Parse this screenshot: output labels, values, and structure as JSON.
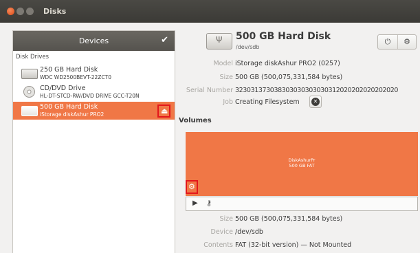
{
  "window": {
    "title": "Disks"
  },
  "sidebar": {
    "header": "Devices",
    "check_glyph": "✔",
    "section_label": "Disk Drives",
    "drives": [
      {
        "name": "250 GB Hard Disk",
        "model": "WDC WD2500BEVT-22ZCT0",
        "icon": "hard-disk-icon"
      },
      {
        "name": "CD/DVD Drive",
        "model": "HL-DT-STCD-RW/DVD DRIVE GCC-T20N",
        "icon": "optical-disc-icon"
      },
      {
        "name": "500 GB Hard Disk",
        "model": "iStorage diskAshur PRO2",
        "icon": "usb-disk-icon",
        "selected": true,
        "eject_glyph": "⏏"
      }
    ]
  },
  "disk": {
    "title": "500 GB Hard Disk",
    "subtitle": "/dev/sdb",
    "icon_glyph": "Ψ",
    "power_glyph": "⏻",
    "gear_glyph": "⚙",
    "properties": {
      "model": {
        "label": "Model",
        "value": "iStorage diskAshur PRO2 (0257)"
      },
      "size": {
        "label": "Size",
        "value": "500 GB (500,075,331,584 bytes)"
      },
      "serial": {
        "label": "Serial Number",
        "value": "323031373038303030303030312020202020202020"
      },
      "job": {
        "label": "Job",
        "value": "Creating Filesystem",
        "stop_glyph": "✕"
      }
    }
  },
  "volumes": {
    "label": "Volumes",
    "partition": {
      "name": "DiskAshurPr",
      "size": "500 GB FAT",
      "color": "#f07746"
    },
    "gear_glyph": "⚙",
    "play_glyph": "▶",
    "key_glyph": "⚷",
    "properties": {
      "size": {
        "label": "Size",
        "value": "500 GB (500,075,331,584 bytes)"
      },
      "device": {
        "label": "Device",
        "value": "/dev/sdb"
      },
      "contents": {
        "label": "Contents",
        "value": "FAT (32-bit version) — Not Mounted"
      }
    }
  },
  "colors": {
    "accent": "#f07746",
    "highlight": "#e3171c"
  }
}
